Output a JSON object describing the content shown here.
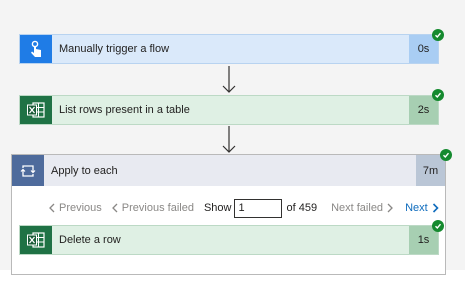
{
  "steps": {
    "trigger": {
      "title": "Manually trigger a flow",
      "duration": "0s",
      "status": "succeeded"
    },
    "list_rows": {
      "title": "List rows present in a table",
      "duration": "2s",
      "status": "succeeded"
    },
    "apply_to_each": {
      "title": "Apply to each",
      "duration": "7m",
      "status": "succeeded"
    },
    "delete_row": {
      "title": "Delete a row",
      "duration": "1s",
      "status": "succeeded"
    }
  },
  "pager": {
    "previous_label": "Previous",
    "previous_failed_label": "Previous failed",
    "show_label": "Show",
    "current_value": "1",
    "of_label": "of 459",
    "next_failed_label": "Next failed",
    "next_label": "Next"
  },
  "colors": {
    "success": "#158a2f",
    "trigger_accent": "#1f7ce6",
    "excel_accent": "#1f7245",
    "loop_accent": "#4e6b9c",
    "link": "#0f6cbd"
  },
  "icons": {
    "trigger": "hand-tap-icon",
    "excel": "excel-icon",
    "loop": "loop-icon",
    "status": "check-icon"
  }
}
